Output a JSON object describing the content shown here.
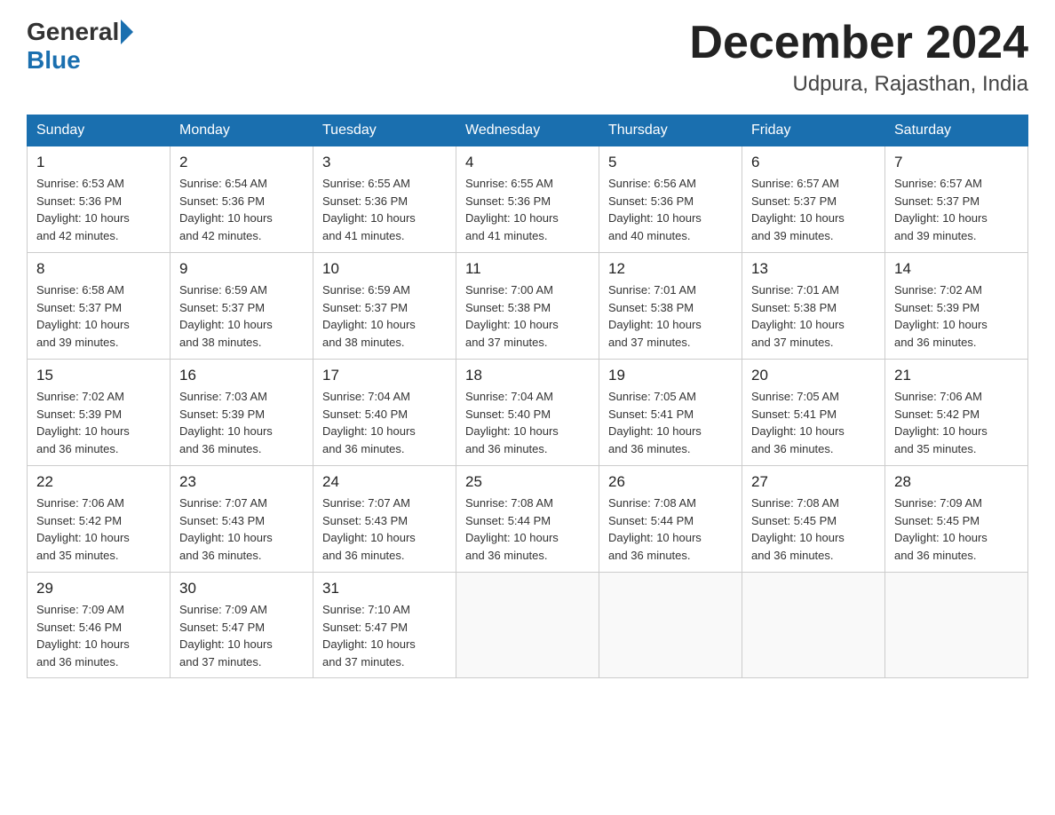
{
  "header": {
    "logo_general": "General",
    "logo_blue": "Blue",
    "month_title": "December 2024",
    "location": "Udpura, Rajasthan, India"
  },
  "days_of_week": [
    "Sunday",
    "Monday",
    "Tuesday",
    "Wednesday",
    "Thursday",
    "Friday",
    "Saturday"
  ],
  "weeks": [
    [
      {
        "day": "1",
        "sunrise": "6:53 AM",
        "sunset": "5:36 PM",
        "daylight": "10 hours and 42 minutes."
      },
      {
        "day": "2",
        "sunrise": "6:54 AM",
        "sunset": "5:36 PM",
        "daylight": "10 hours and 42 minutes."
      },
      {
        "day": "3",
        "sunrise": "6:55 AM",
        "sunset": "5:36 PM",
        "daylight": "10 hours and 41 minutes."
      },
      {
        "day": "4",
        "sunrise": "6:55 AM",
        "sunset": "5:36 PM",
        "daylight": "10 hours and 41 minutes."
      },
      {
        "day": "5",
        "sunrise": "6:56 AM",
        "sunset": "5:36 PM",
        "daylight": "10 hours and 40 minutes."
      },
      {
        "day": "6",
        "sunrise": "6:57 AM",
        "sunset": "5:37 PM",
        "daylight": "10 hours and 39 minutes."
      },
      {
        "day": "7",
        "sunrise": "6:57 AM",
        "sunset": "5:37 PM",
        "daylight": "10 hours and 39 minutes."
      }
    ],
    [
      {
        "day": "8",
        "sunrise": "6:58 AM",
        "sunset": "5:37 PM",
        "daylight": "10 hours and 39 minutes."
      },
      {
        "day": "9",
        "sunrise": "6:59 AM",
        "sunset": "5:37 PM",
        "daylight": "10 hours and 38 minutes."
      },
      {
        "day": "10",
        "sunrise": "6:59 AM",
        "sunset": "5:37 PM",
        "daylight": "10 hours and 38 minutes."
      },
      {
        "day": "11",
        "sunrise": "7:00 AM",
        "sunset": "5:38 PM",
        "daylight": "10 hours and 37 minutes."
      },
      {
        "day": "12",
        "sunrise": "7:01 AM",
        "sunset": "5:38 PM",
        "daylight": "10 hours and 37 minutes."
      },
      {
        "day": "13",
        "sunrise": "7:01 AM",
        "sunset": "5:38 PM",
        "daylight": "10 hours and 37 minutes."
      },
      {
        "day": "14",
        "sunrise": "7:02 AM",
        "sunset": "5:39 PM",
        "daylight": "10 hours and 36 minutes."
      }
    ],
    [
      {
        "day": "15",
        "sunrise": "7:02 AM",
        "sunset": "5:39 PM",
        "daylight": "10 hours and 36 minutes."
      },
      {
        "day": "16",
        "sunrise": "7:03 AM",
        "sunset": "5:39 PM",
        "daylight": "10 hours and 36 minutes."
      },
      {
        "day": "17",
        "sunrise": "7:04 AM",
        "sunset": "5:40 PM",
        "daylight": "10 hours and 36 minutes."
      },
      {
        "day": "18",
        "sunrise": "7:04 AM",
        "sunset": "5:40 PM",
        "daylight": "10 hours and 36 minutes."
      },
      {
        "day": "19",
        "sunrise": "7:05 AM",
        "sunset": "5:41 PM",
        "daylight": "10 hours and 36 minutes."
      },
      {
        "day": "20",
        "sunrise": "7:05 AM",
        "sunset": "5:41 PM",
        "daylight": "10 hours and 36 minutes."
      },
      {
        "day": "21",
        "sunrise": "7:06 AM",
        "sunset": "5:42 PM",
        "daylight": "10 hours and 35 minutes."
      }
    ],
    [
      {
        "day": "22",
        "sunrise": "7:06 AM",
        "sunset": "5:42 PM",
        "daylight": "10 hours and 35 minutes."
      },
      {
        "day": "23",
        "sunrise": "7:07 AM",
        "sunset": "5:43 PM",
        "daylight": "10 hours and 36 minutes."
      },
      {
        "day": "24",
        "sunrise": "7:07 AM",
        "sunset": "5:43 PM",
        "daylight": "10 hours and 36 minutes."
      },
      {
        "day": "25",
        "sunrise": "7:08 AM",
        "sunset": "5:44 PM",
        "daylight": "10 hours and 36 minutes."
      },
      {
        "day": "26",
        "sunrise": "7:08 AM",
        "sunset": "5:44 PM",
        "daylight": "10 hours and 36 minutes."
      },
      {
        "day": "27",
        "sunrise": "7:08 AM",
        "sunset": "5:45 PM",
        "daylight": "10 hours and 36 minutes."
      },
      {
        "day": "28",
        "sunrise": "7:09 AM",
        "sunset": "5:45 PM",
        "daylight": "10 hours and 36 minutes."
      }
    ],
    [
      {
        "day": "29",
        "sunrise": "7:09 AM",
        "sunset": "5:46 PM",
        "daylight": "10 hours and 36 minutes."
      },
      {
        "day": "30",
        "sunrise": "7:09 AM",
        "sunset": "5:47 PM",
        "daylight": "10 hours and 37 minutes."
      },
      {
        "day": "31",
        "sunrise": "7:10 AM",
        "sunset": "5:47 PM",
        "daylight": "10 hours and 37 minutes."
      },
      null,
      null,
      null,
      null
    ]
  ],
  "labels": {
    "sunrise": "Sunrise:",
    "sunset": "Sunset:",
    "daylight": "Daylight:"
  }
}
